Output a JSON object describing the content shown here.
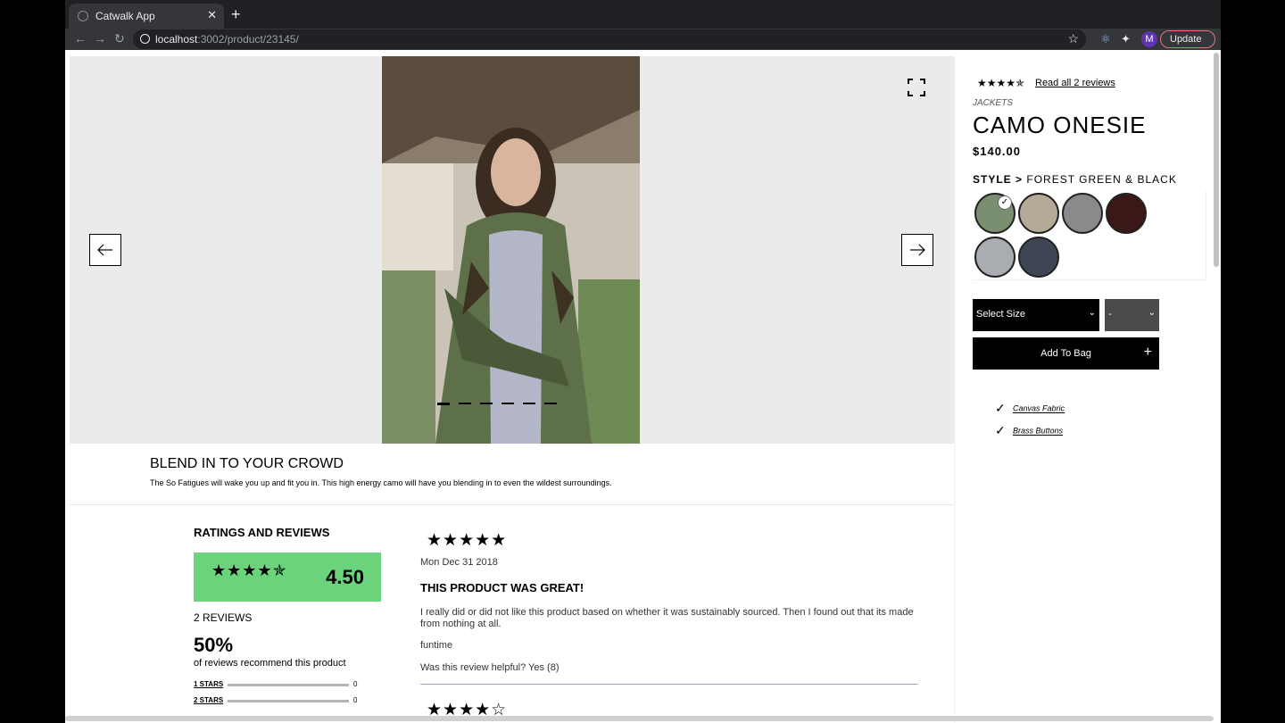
{
  "browser": {
    "tab_title": "Catwalk App",
    "url_host": "localhost",
    "url_rest": ":3002/product/23145/",
    "profile_initial": "M",
    "update_label": "Update"
  },
  "product": {
    "rating_stars": "★★★★✯",
    "reviews_link": "Read all 2 reviews",
    "category": "JACKETS",
    "name": "CAMO ONESIE",
    "price": "$140.00",
    "style_prefix": "STYLE >",
    "style_name": "FOREST GREEN & BLACK",
    "size_select": "Select Size",
    "qty_select": "-",
    "add_to_bag": "Add To Bag",
    "features": [
      "Canvas Fabric",
      "Brass Buttons"
    ]
  },
  "overview": {
    "slogan": "BLEND IN TO YOUR CROWD",
    "description": "The So Fatigues will wake you up and fit you in. This high energy camo will have you blending in to even the wildest surroundings."
  },
  "ratings": {
    "title": "RATINGS AND REVIEWS",
    "average": "4.50",
    "average_stars": "★★★★✯",
    "box_color": "#6ad37b",
    "reviews_count": "2 REVIEWS",
    "recommend_pct": "50%",
    "recommend_text": "of reviews recommend this product",
    "breakdown": [
      {
        "label": "1 STARS",
        "count": "0"
      },
      {
        "label": "2 STARS",
        "count": "0"
      }
    ]
  },
  "reviews": [
    {
      "stars": "★★★★★",
      "date": "Mon Dec 31 2018",
      "title": "THIS PRODUCT WAS GREAT!",
      "body": "I really did or did not like this product based on whether it was sustainably sourced. Then I found out that its made from nothing at all.",
      "user": "funtime",
      "helpful": "Was this review helpful? Yes (8)"
    },
    {
      "stars": "★★★★☆"
    }
  ]
}
